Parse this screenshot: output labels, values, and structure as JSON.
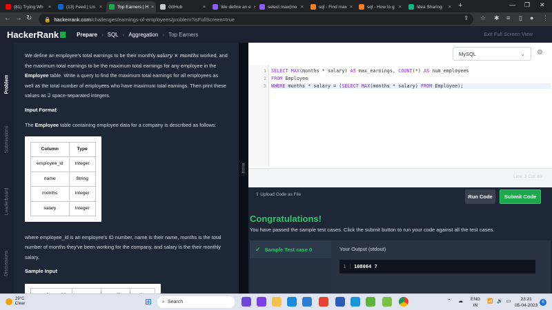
{
  "browser": {
    "tabs": [
      {
        "label": "(81) Trying Wh",
        "color": "#ff0000",
        "active": false
      },
      {
        "label": "(13) Feed | Lin",
        "color": "#0a66c2",
        "active": false
      },
      {
        "label": "Top Earners | H",
        "color": "#1ba94c",
        "active": true
      },
      {
        "label": "GitHub",
        "color": "#cccccc",
        "active": false
      },
      {
        "label": "We define an e",
        "color": "#8b5cf6",
        "active": false
      },
      {
        "label": "select max(mo",
        "color": "#8b5cf6",
        "active": false
      },
      {
        "label": "sql - Find max",
        "color": "#f48024",
        "active": false
      },
      {
        "label": "sql - How to g",
        "color": "#f48024",
        "active": false
      },
      {
        "label": "Idea Sharing",
        "color": "#10b981",
        "active": false
      }
    ],
    "url_host": "hackerrank.com",
    "url_path": "/challenges/earnings-of-employees/problem?isFullScreen=true"
  },
  "header": {
    "logo": "HackerRank",
    "breadcrumbs": [
      "Prepare",
      "SQL",
      "Aggregation",
      "Top Earners"
    ],
    "exit_label": "Exit Full Screen View"
  },
  "side_tabs": [
    "Problem",
    "Submissions",
    "Leaderboard",
    "Discussions"
  ],
  "problem": {
    "intro_1": "We define an employee's total earnings to be their monthly ",
    "intro_math": "salary × months",
    "intro_2": " worked, and the maximum total earnings to be the maximum total earnings for any employee in the ",
    "intro_table": "Employee",
    "intro_3": " table. Write a query to find the maximum total earnings for all employees as well as the total number of employees who have maximum total earnings. Then print these values as ",
    "intro_num": "2",
    "intro_4": " space-separated integers.",
    "input_format_heading": "Input Format",
    "input_desc_1": "The ",
    "input_desc_table": "Employee",
    "input_desc_2": " table containing employee data for a company is described as follows:",
    "schema_headers": [
      "Column",
      "Type"
    ],
    "schema_rows": [
      [
        "employee_id",
        "Integer"
      ],
      [
        "name",
        "String"
      ],
      [
        "months",
        "Integer"
      ],
      [
        "salary",
        "Integer"
      ]
    ],
    "where_text": "where employee_id is an employee's ID number, name is their name, months is the total number of months they've been working for the company, and salary is the their monthly salary.",
    "sample_input_heading": "Sample Input",
    "sample_headers": [
      "employee_id",
      "name",
      "months",
      "salary"
    ]
  },
  "editor": {
    "language": "MySQL",
    "lines": [
      {
        "n": "1",
        "text": "SELECT MAX(months * salary) AS max_earnings, COUNT(*) AS num_employees"
      },
      {
        "n": "2",
        "text": "FROM Employee"
      },
      {
        "n": "3",
        "text": "WHERE months * salary = (SELECT MAX(months * salary) FROM Employee);"
      }
    ],
    "cursor_status": "Line: 3 Col: 69"
  },
  "actions": {
    "upload_label": "Upload Code as File",
    "run_label": "Run Code",
    "submit_label": "Submit Code",
    "congrats": "Congratulations!",
    "pass_message": "You have passed the sample test cases. Click the submit button to run your code against all the test cases.",
    "testcase_label": "Sample Test case 0",
    "output_label": "Your Output (stdout)",
    "output_line_no": "1",
    "output_value": "108064 7"
  },
  "taskbar": {
    "temp": "29°C",
    "condition": "Clear",
    "search_placeholder": "Search",
    "lang_line1": "ENG",
    "lang_line2": "IN",
    "time": "23:21",
    "date": "05-04-2023",
    "notif_count": "6"
  }
}
